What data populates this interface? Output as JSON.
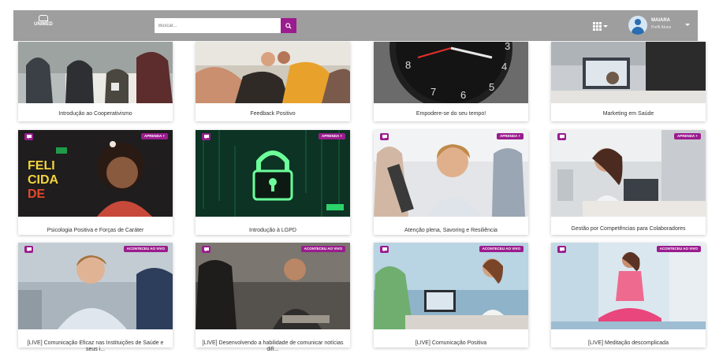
{
  "header": {
    "logo_text": "UNIMED",
    "search_placeholder": "Buscar...",
    "search_icon": "search-icon",
    "apps_icon": "apps-grid-icon",
    "user": {
      "name": "MAIARA",
      "role": "Perfil Aluno"
    }
  },
  "colors": {
    "accent": "#9b1c8e",
    "topbar": "#9e9e9e"
  },
  "courses_row1": [
    {
      "title": "Introdução ao Cooperativismo"
    },
    {
      "title": "Feedback Positivo"
    },
    {
      "title": "Empodere-se do seu tempo!"
    },
    {
      "title": "Marketing em Saúde"
    }
  ],
  "courses_row2": [
    {
      "title": "Psicologia Positiva e Forças de Caráter",
      "badge": "APRENDA +"
    },
    {
      "title": "Introdução à LGPD",
      "badge": "APRENDA +"
    },
    {
      "title": "Atenção plena, Savoring e Resiliência",
      "badge": "APRENDA +"
    },
    {
      "title": "Gestão por Competências para Colaboradores",
      "badge": "APRENDA +"
    }
  ],
  "courses_row3": [
    {
      "title": "[LIVE] Comunicação Eficaz nas Instituições de Saúde e seus i...",
      "badge": "ACONTECEU AO VIVO"
    },
    {
      "title": "[LIVE] Desenvolvendo a habilidade de comunicar notícias difí...",
      "badge": "ACONTECEU AO VIVO"
    },
    {
      "title": "[LIVE] Comunicação Positiva",
      "badge": "ACONTECEU AO VIVO"
    },
    {
      "title": "[LIVE] Meditação descomplicada",
      "badge": "ACONTECEU AO VIVO"
    }
  ],
  "felicidade_art": {
    "line1": "FELI",
    "line2": "CIDA",
    "line3": "DE"
  }
}
